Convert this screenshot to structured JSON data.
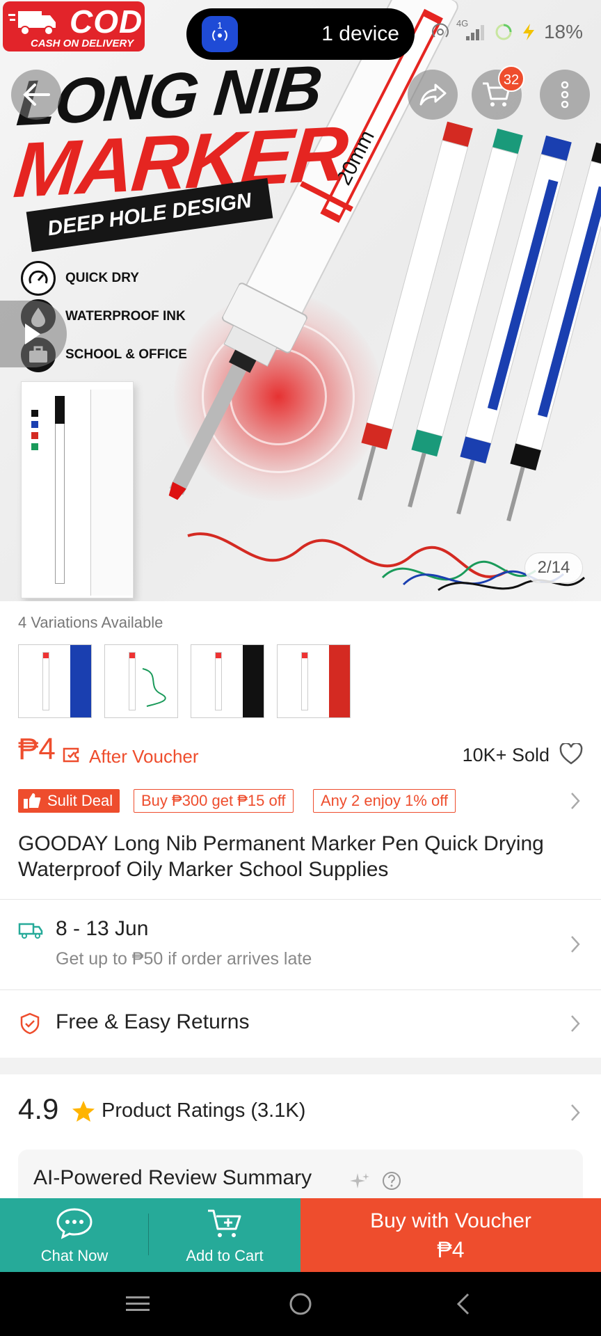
{
  "hero": {
    "cod_title": "COD",
    "cod_sub": "CASH ON DELIVERY",
    "headline_line1": "LONG NIB",
    "headline_line2": "MARKER",
    "headline_banner": "DEEP HOLE DESIGN",
    "features": [
      "QUICK DRY",
      "WATERPROOF INK",
      "SCHOOL & OFFICE"
    ],
    "pen_size": "20mm",
    "gallery_counter": "2/14"
  },
  "status_bar": {
    "pill_badge": "1",
    "pill_text": "1 device",
    "network": "4G",
    "battery": "18%"
  },
  "top_actions": {
    "cart_count": "32"
  },
  "variations": {
    "title": "4 Variations Available",
    "items": [
      {
        "name": "Blue",
        "color": "#1a3fb0"
      },
      {
        "name": "Green",
        "color": "#1a9a5a"
      },
      {
        "name": "Black",
        "color": "#111111"
      },
      {
        "name": "Red",
        "color": "#d42a22"
      }
    ]
  },
  "price": {
    "amount": "₱4",
    "after_voucher": "After Voucher",
    "sold": "10K+ Sold"
  },
  "deals": {
    "main": "Sulit Deal",
    "tag1": "Buy ₱300 get ₱15 off",
    "tag2": "Any 2 enjoy 1% off"
  },
  "product": {
    "title": "GOODAY Long Nib Permanent Marker Pen Quick Drying Waterproof Oily Marker School Supplies"
  },
  "shipping": {
    "date": "8 - 13 Jun",
    "guarantee": "Get up to ₱50 if order arrives late"
  },
  "returns": {
    "label": "Free & Easy Returns"
  },
  "ratings": {
    "score": "4.9",
    "label": "Product Ratings (3.1K)",
    "ai_summary": "AI-Powered Review Summary"
  },
  "bottom_bar": {
    "chat": "Chat Now",
    "add_to_cart": "Add to Cart",
    "buy_line1": "Buy with Voucher",
    "buy_line2": "₱4"
  },
  "colors": {
    "accent": "#ee4d2d",
    "teal": "#26aa99"
  }
}
